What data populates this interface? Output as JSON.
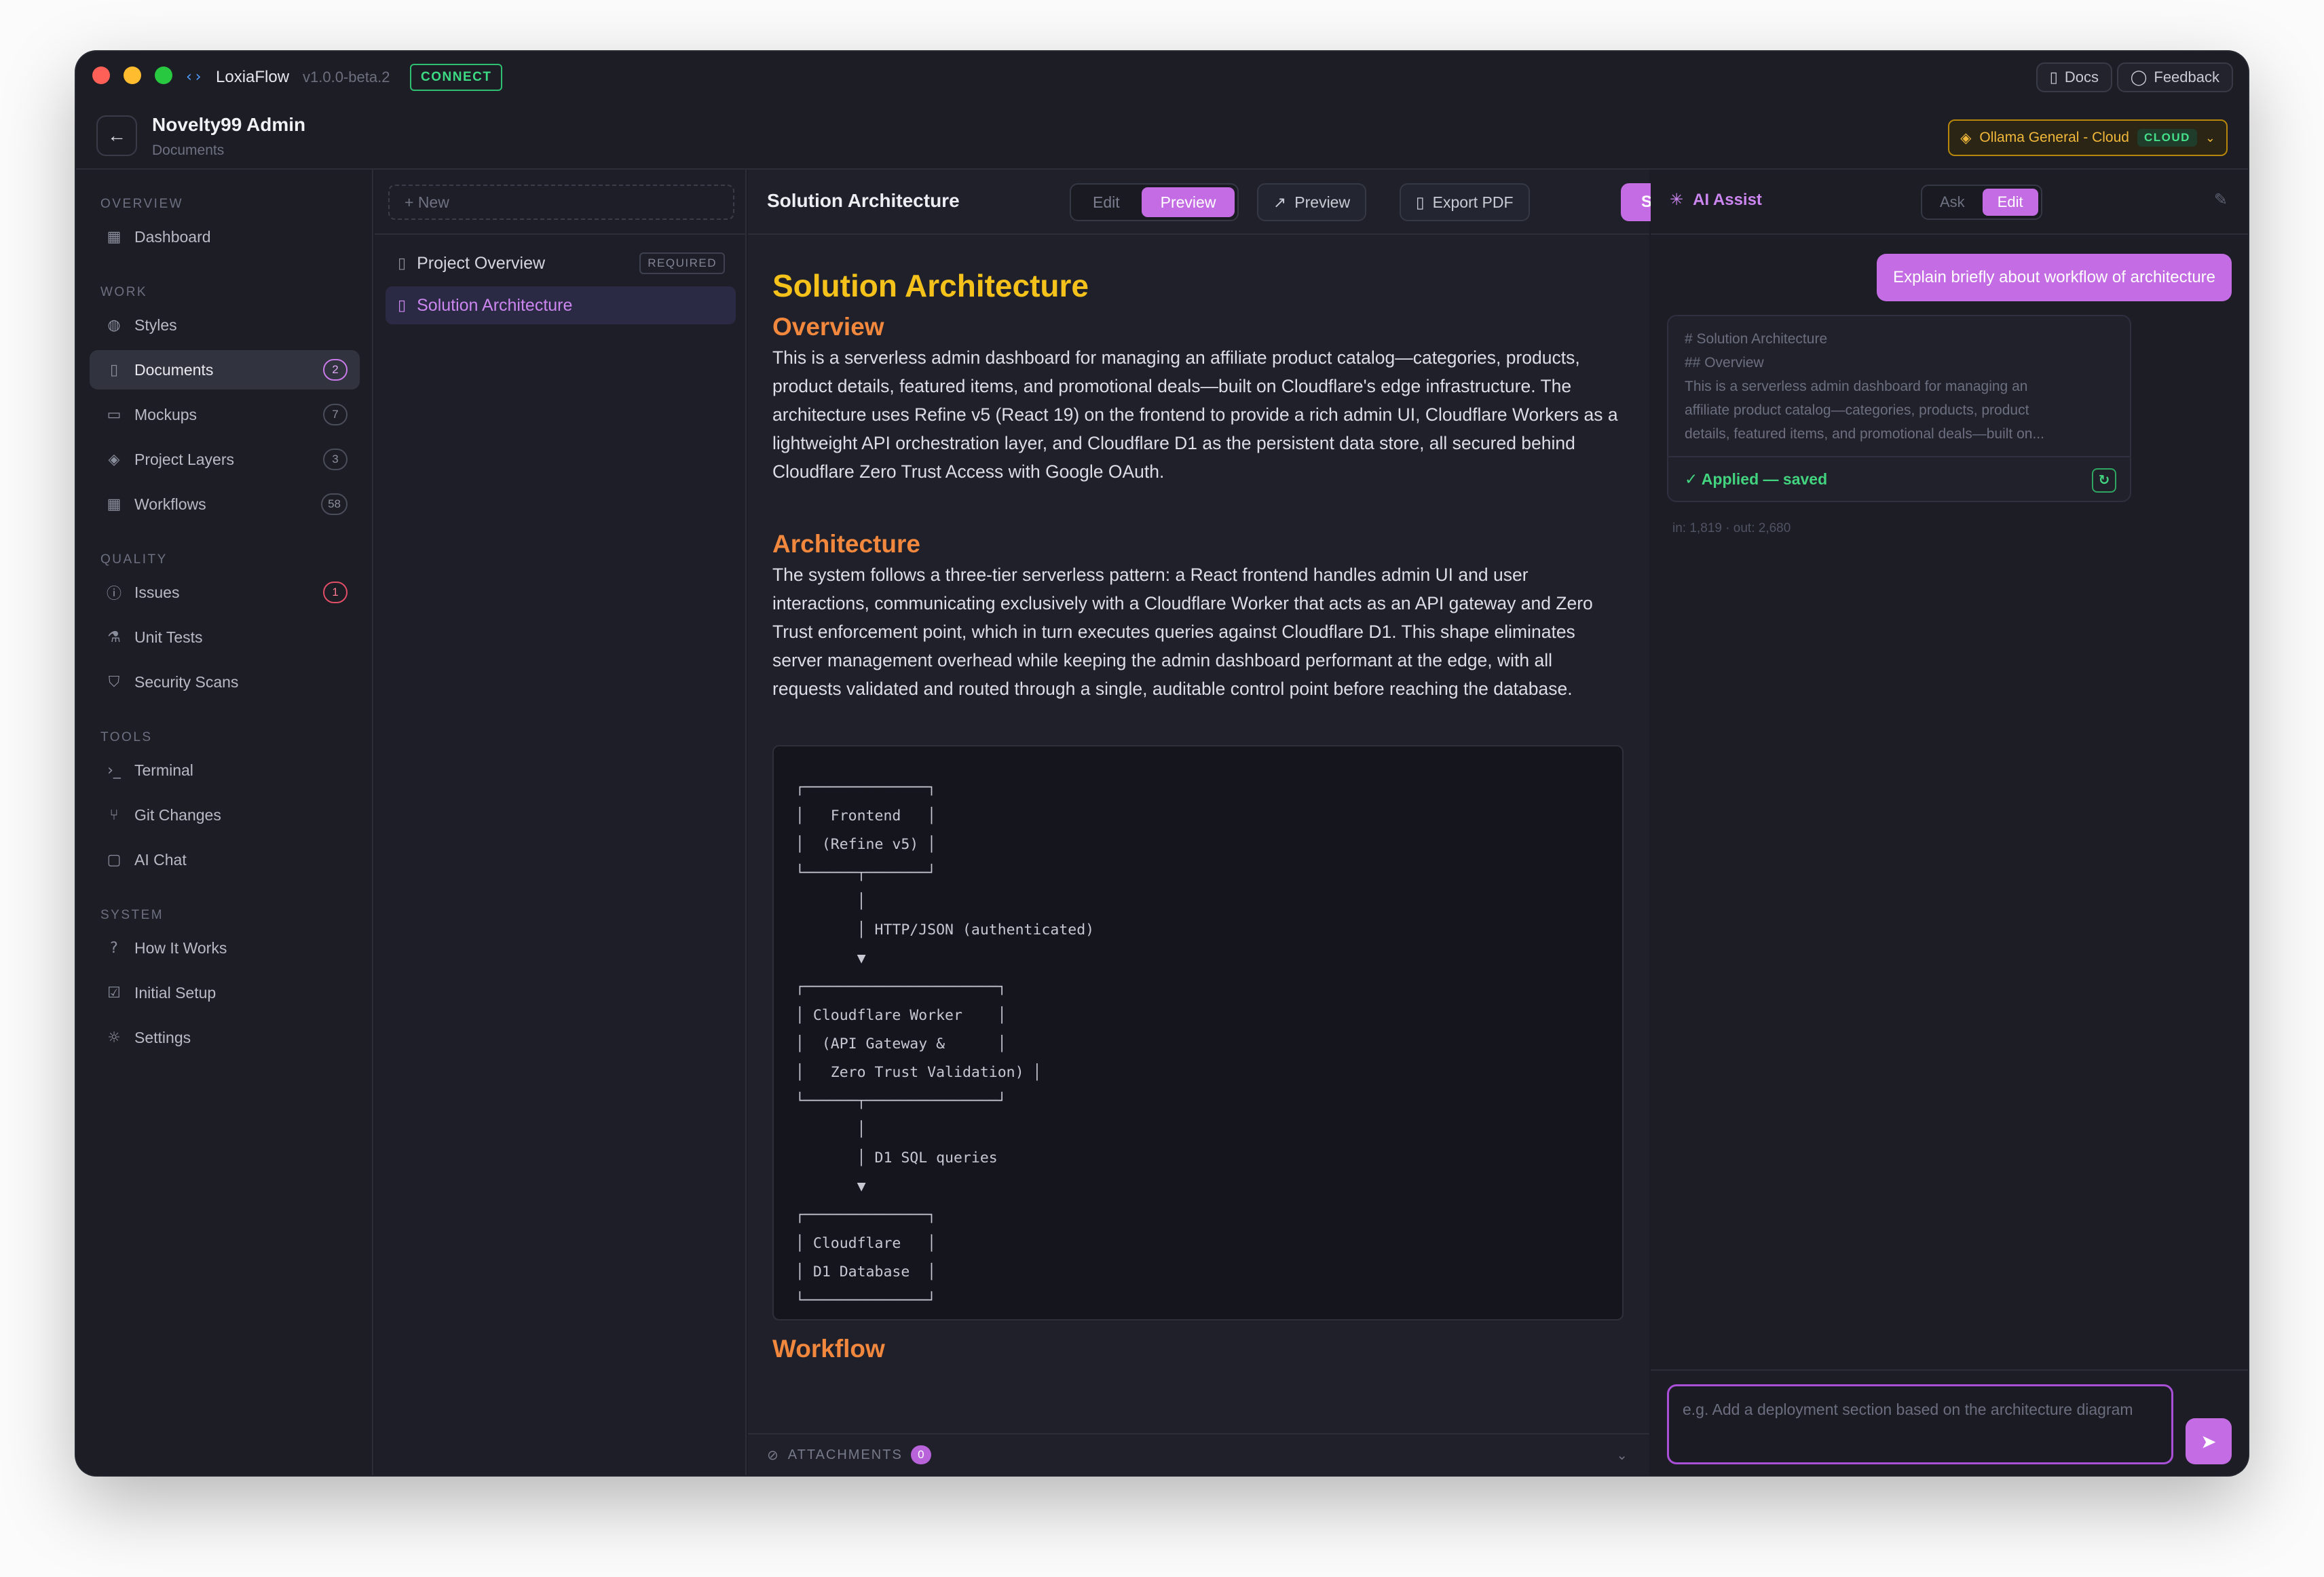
{
  "app": {
    "name": "LoxiaFlow",
    "version": "v1.0.0-beta.2",
    "connect_label": "CONNECT",
    "docs_label": "Docs",
    "feedback_label": "Feedback"
  },
  "project": {
    "title": "Novelty99 Admin",
    "subtitle": "Documents"
  },
  "model": {
    "name": "Ollama General - Cloud",
    "tag": "CLOUD"
  },
  "sidebar": {
    "sections": [
      "OVERVIEW",
      "WORK",
      "QUALITY",
      "TOOLS",
      "SYSTEM"
    ],
    "items": [
      {
        "label": "Dashboard",
        "icon": "grid-icon"
      },
      {
        "label": "Styles",
        "icon": "palette-icon"
      },
      {
        "label": "Documents",
        "icon": "file-icon",
        "badge": "2"
      },
      {
        "label": "Mockups",
        "icon": "monitor-icon",
        "badge": "7"
      },
      {
        "label": "Project Layers",
        "icon": "layers-icon",
        "badge": "3"
      },
      {
        "label": "Workflows",
        "icon": "grid-icon",
        "badge": "58"
      },
      {
        "label": "Issues",
        "icon": "alert-circle-icon",
        "badge": "1"
      },
      {
        "label": "Unit Tests",
        "icon": "flask-icon"
      },
      {
        "label": "Security Scans",
        "icon": "shield-icon"
      },
      {
        "label": "Terminal",
        "icon": "terminal-icon"
      },
      {
        "label": "Git Changes",
        "icon": "git-branch-icon"
      },
      {
        "label": "AI Chat",
        "icon": "chat-icon"
      },
      {
        "label": "How It Works",
        "icon": "help-circle-icon"
      },
      {
        "label": "Initial Setup",
        "icon": "checkbox-icon"
      },
      {
        "label": "Settings",
        "icon": "gear-icon"
      }
    ]
  },
  "doclist": {
    "new_label": "+ New",
    "items": [
      {
        "label": "Project Overview",
        "tag": "REQUIRED"
      },
      {
        "label": "Solution Architecture"
      }
    ]
  },
  "editor": {
    "title": "Solution Architecture",
    "mode_edit": "Edit",
    "mode_preview": "Preview",
    "preview_label": "Preview",
    "export_label": "Export PDF",
    "save_label": "Save",
    "doc": {
      "h1": "Solution Architecture",
      "overview_heading": "Overview",
      "overview_text": "This is a serverless admin dashboard for managing an affiliate product catalog—categories, products, product details, featured items, and promotional deals—built on Cloudflare's edge infrastructure. The architecture uses Refine v5 (React 19) on the frontend to provide a rich admin UI, Cloudflare Workers as a lightweight API orchestration layer, and Cloudflare D1 as the persistent data store, all secured behind Cloudflare Zero Trust Access with Google OAuth.",
      "architecture_heading": "Architecture",
      "architecture_text": "The system follows a three-tier serverless pattern: a React frontend handles admin UI and user interactions, communicating exclusively with a Cloudflare Worker that acts as an API gateway and Zero Trust enforcement point, which in turn executes queries against Cloudflare D1. This shape eliminates server management overhead while keeping the admin dashboard performant at the edge, with all requests validated and routed through a single, auditable control point before reaching the database.",
      "diagram": "┌──────────────┐\n│   Frontend   │\n│  (Refine v5) │\n└──────┬───────┘\n       │\n       │ HTTP/JSON (authenticated)\n       ▼\n┌──────────────────────┐\n│ Cloudflare Worker    │\n│  (API Gateway &      │\n│   Zero Trust Validation) │\n└──────┬───────────────┘\n       │\n       │ D1 SQL queries\n       ▼\n┌──────────────┐\n│ Cloudflare   │\n│ D1 Database  │\n└──────────────┘",
      "workflow_heading": "Workflow"
    },
    "attachments_label": "ATTACHMENTS",
    "attachments_count": "0"
  },
  "ai": {
    "title": "AI Assist",
    "mode_ask": "Ask",
    "mode_edit": "Edit",
    "user_message": "Explain briefly about workflow of architecture",
    "response_lines": [
      "# Solution Architecture",
      "## Overview",
      "This is a serverless admin dashboard for managing an",
      "affiliate product catalog—categories, products, product",
      "details, featured items, and promotional deals—built on..."
    ],
    "applied_label": "✓ Applied — saved",
    "tokens": "in: 1,819 · out: 2,680",
    "input_placeholder": "e.g. Add a deployment section based on the architecture diagram"
  },
  "colors": {
    "accent": "#c46ce3",
    "heading_h1": "#f4c21b",
    "heading_h2": "#f2883d",
    "success": "#3ddc84"
  }
}
